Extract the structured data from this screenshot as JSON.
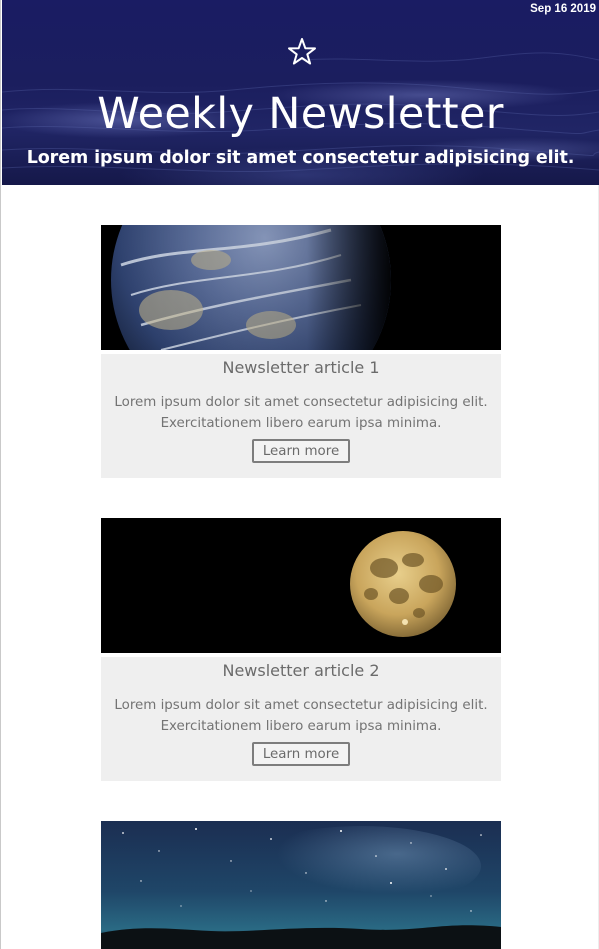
{
  "header": {
    "date": "Sep 16 2019",
    "icon": "star-icon",
    "title": "Weekly Newsletter",
    "subtitle": "Lorem ipsum dolor sit amet consectetur adipisicing elit."
  },
  "articles": [
    {
      "image": "earth-image",
      "title": "Newsletter article 1",
      "text_line1": "Lorem ipsum dolor sit amet consectetur adipisicing elit.",
      "text_line2": "Exercitationem libero earum ipsa minima.",
      "button_label": "Learn more"
    },
    {
      "image": "moon-image",
      "title": "Newsletter article 2",
      "text_line1": "Lorem ipsum dolor sit amet consectetur adipisicing elit.",
      "text_line2": "Exercitationem libero earum ipsa minima.",
      "button_label": "Learn more"
    },
    {
      "image": "night-sky-image"
    }
  ],
  "colors": {
    "header_background": "#1b1e5e",
    "card_background": "#efefef",
    "text_gray": "#737373",
    "button_border": "#7d7d7d"
  }
}
